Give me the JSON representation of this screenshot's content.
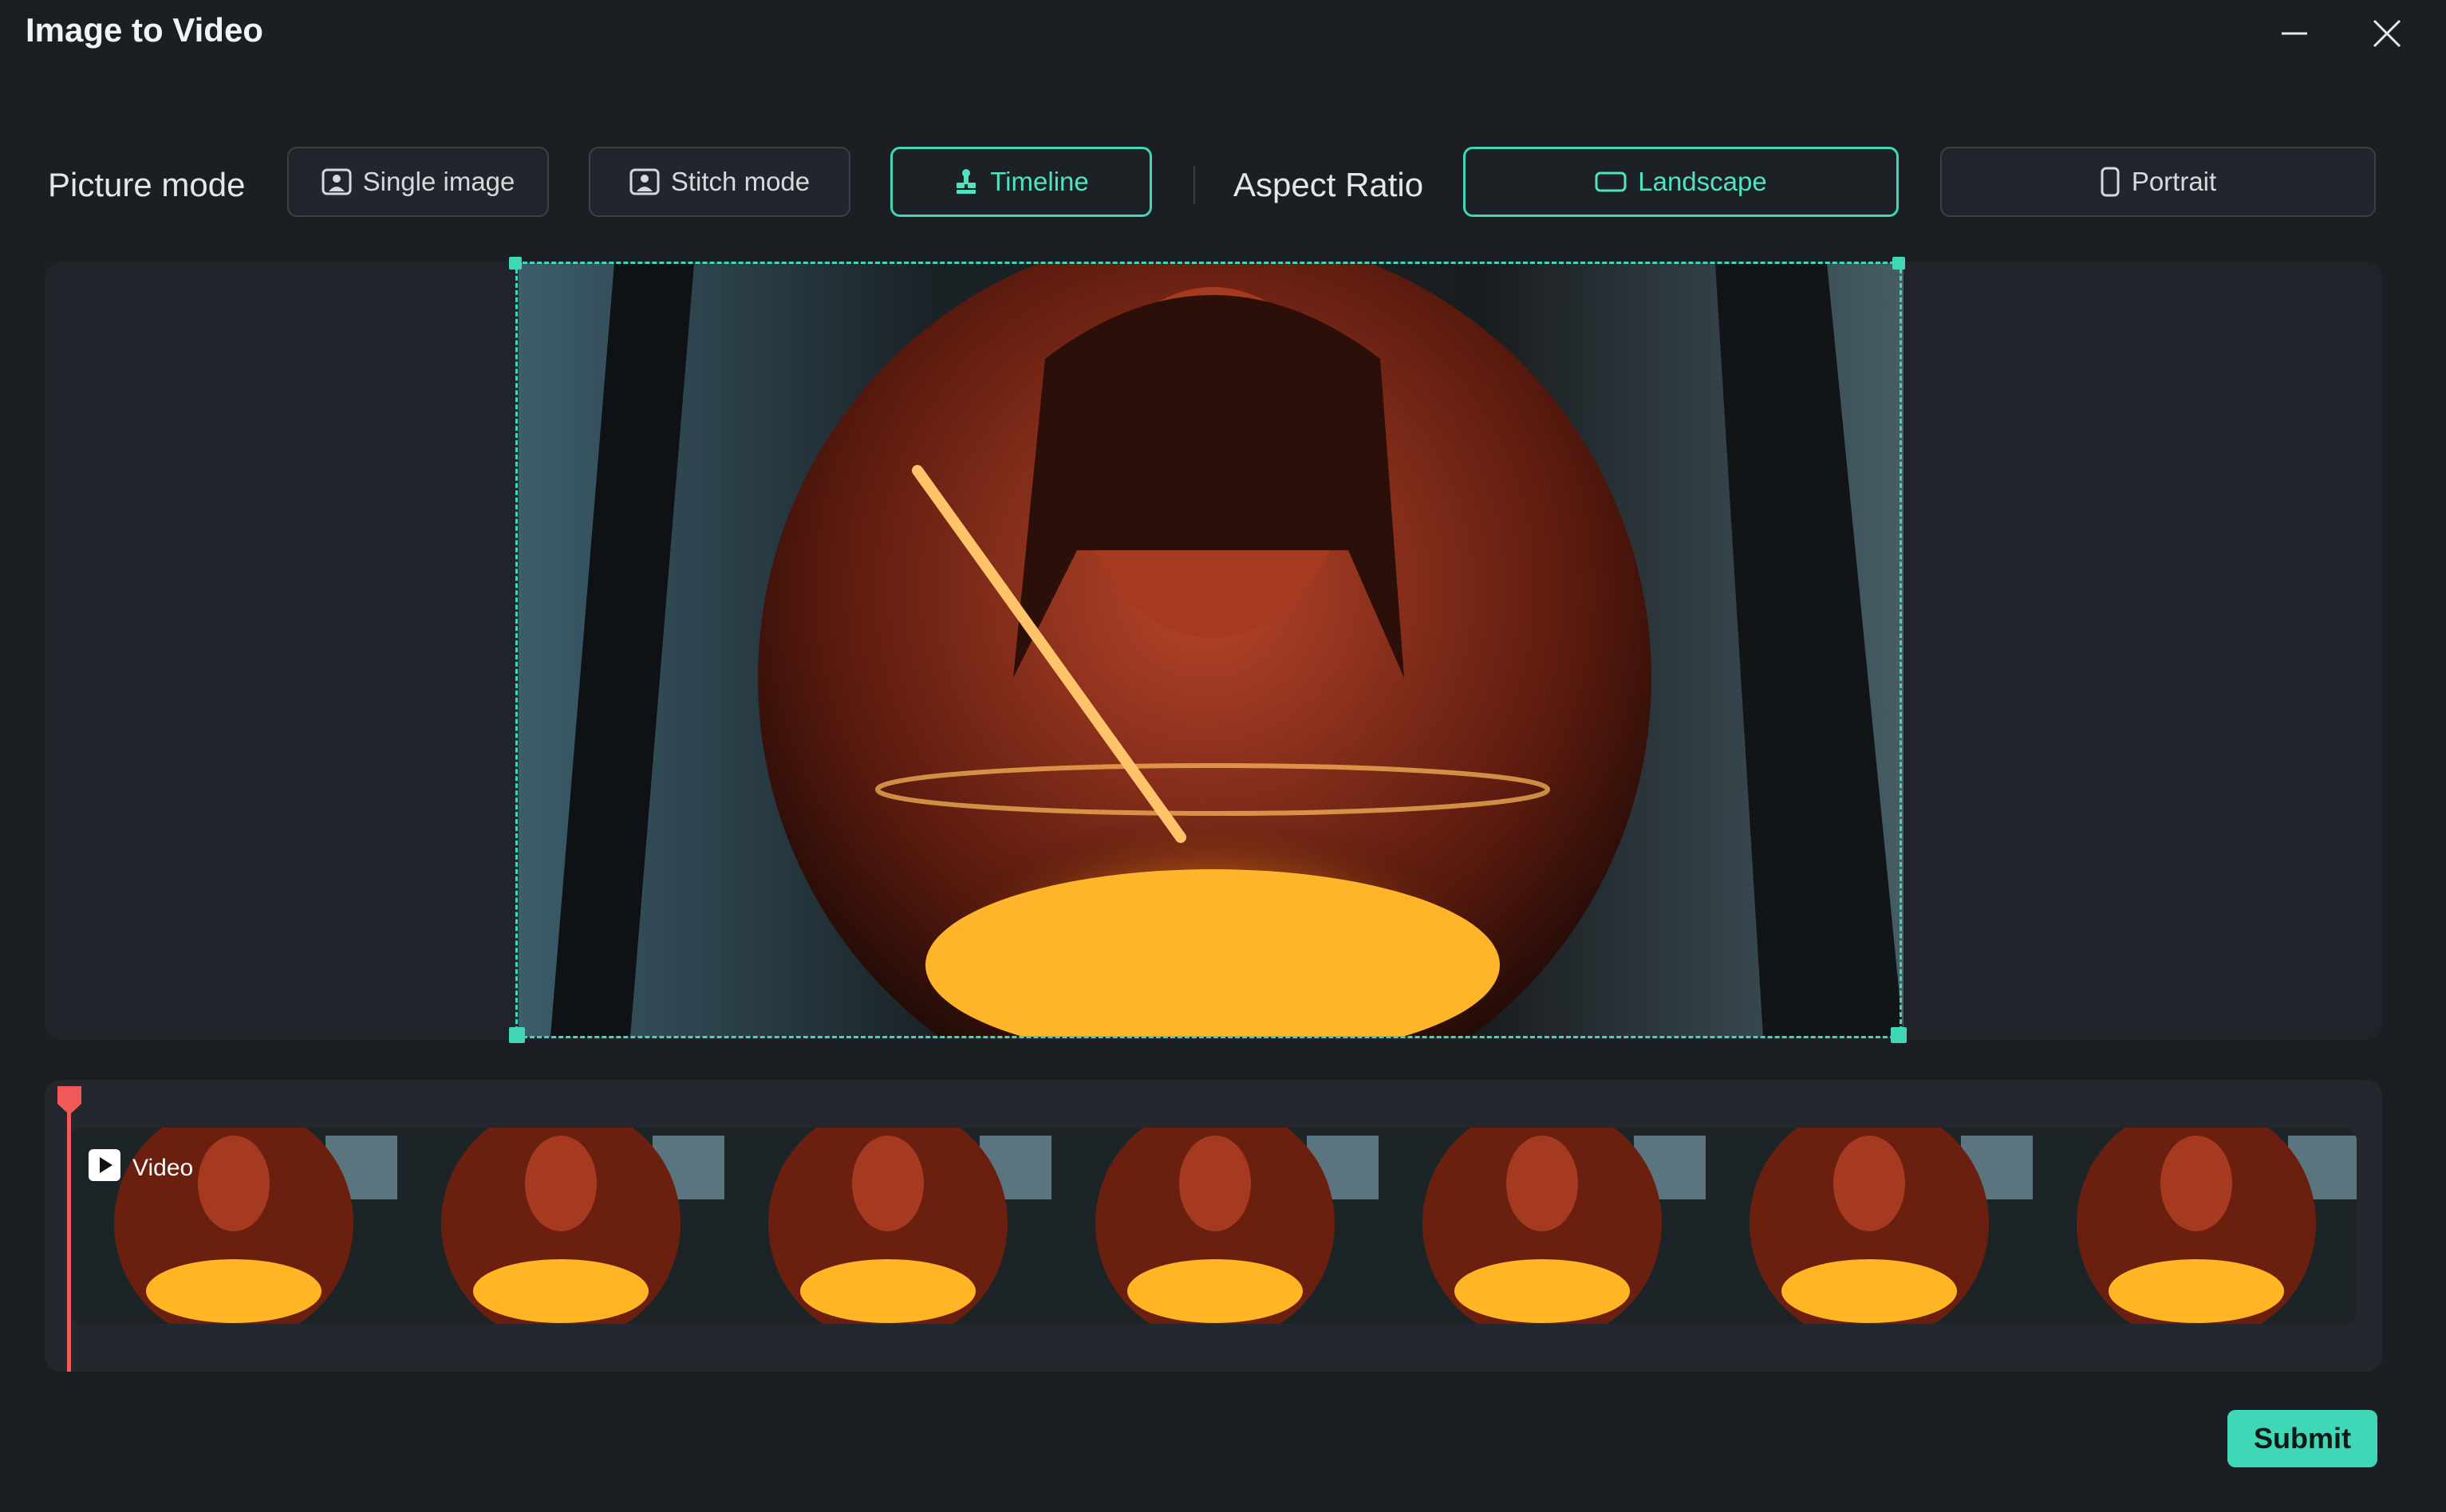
{
  "window": {
    "title": "Image to Video",
    "minimize_icon": "minimize-icon",
    "close_icon": "close-icon"
  },
  "mode_bar": {
    "picture_mode_label": "Picture mode",
    "modes": [
      {
        "label": "Single image",
        "icon": "portrait-frame-icon",
        "active": false
      },
      {
        "label": "Stitch mode",
        "icon": "portrait-frame-icon",
        "active": false
      },
      {
        "label": "Timeline",
        "icon": "timeline-icon",
        "active": true
      }
    ],
    "aspect_ratio_label": "Aspect Ratio",
    "ratios": [
      {
        "label": "Landscape",
        "icon": "landscape-icon",
        "active": true
      },
      {
        "label": "Portrait",
        "icon": "portrait-icon",
        "active": false
      }
    ]
  },
  "preview": {
    "subject": "woman eating glowing bowl in car"
  },
  "timeline": {
    "clip_label": "Video",
    "clip_icon": "play-icon",
    "thumbnail_count": 7
  },
  "footer": {
    "submit_label": "Submit"
  },
  "colors": {
    "accent": "#3fd7b6",
    "playhead": "#f25a5a",
    "background": "#1b1e23"
  }
}
